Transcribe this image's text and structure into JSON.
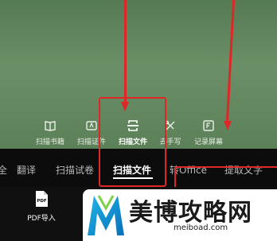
{
  "modes": [
    {
      "label": "扫描书籍",
      "icon": "book-icon"
    },
    {
      "label": "扫描证件",
      "icon": "id-card-icon"
    },
    {
      "label": "扫描文件",
      "icon": "scan-file-icon",
      "active": true
    },
    {
      "label": "去手写",
      "icon": "erase-handwriting-icon"
    },
    {
      "label": "记录屏幕",
      "icon": "record-screen-icon"
    }
  ],
  "tabs": [
    {
      "label": "全"
    },
    {
      "label": "翻译"
    },
    {
      "label": "扫描试卷"
    },
    {
      "label": "扫描文件",
      "active": true
    },
    {
      "label": "转Office"
    },
    {
      "label": "提取文字"
    }
  ],
  "pdf_import": {
    "label": "PDF导入",
    "icon_text": "PDF"
  },
  "watermark": {
    "title": "美博攻略网",
    "domain": "meiboad.com"
  },
  "colors": {
    "annotation": "#e02727",
    "camera_bg": "#5f835b",
    "dark_bg": "#0c0c0c"
  }
}
